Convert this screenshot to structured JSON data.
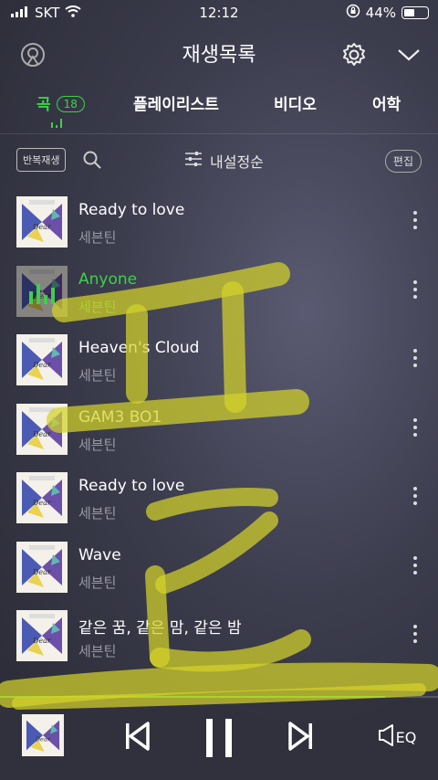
{
  "status": {
    "carrier": "SKT",
    "time": "12:12",
    "battery": "44%",
    "battery_level": 0.44
  },
  "header": {
    "title": "재생목록",
    "left_icon": "playlist-sync-icon",
    "settings_icon": "gear-icon",
    "collapse_icon": "chevron-down-icon"
  },
  "tabs": [
    {
      "label": "곡",
      "badge": "18",
      "active": true
    },
    {
      "label": "플레이리스트"
    },
    {
      "label": "비디오"
    },
    {
      "label": "어학"
    }
  ],
  "toolbar": {
    "repeat_label": "반복재생",
    "sort_label": "내설정순",
    "edit_label": "편집"
  },
  "tracks": [
    {
      "title": "Ready to love",
      "artist": "세븐틴"
    },
    {
      "title": "Anyone",
      "artist": "세븐틴",
      "playing": true
    },
    {
      "title": "Heaven's Cloud",
      "artist": "세븐틴"
    },
    {
      "title": "GAM3 BO1",
      "artist": "세븐틴"
    },
    {
      "title": "Ready to love",
      "artist": "세븐틴"
    },
    {
      "title": "Wave",
      "artist": "세븐틴"
    },
    {
      "title": "같은 꿈, 같은 맘, 같은 밤",
      "artist": "세븐틴"
    }
  ],
  "player": {
    "eq_label": "EQ",
    "progress": 0.88
  },
  "colors": {
    "accent": "#3cd14a",
    "overlay_scribble": "#d4d22a"
  }
}
